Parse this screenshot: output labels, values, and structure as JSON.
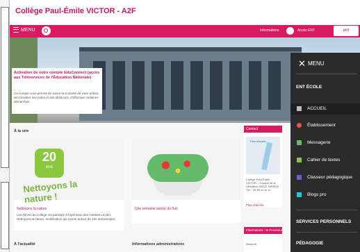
{
  "site": {
    "title": "Collège Paul-Émile VICTOR - A2F",
    "brand": "#d81b60"
  },
  "navbar": {
    "menu_label": "MENU",
    "right_a": "Informations",
    "right_b": "Accès ENT",
    "logo": "ent"
  },
  "hero": {
    "title": "Activation de votre compte EduConnect (accès aux Téléservices de l'Éducation Nationale)",
    "text": "Ce compte vous permet de suivre la scolarité de votre enfant, de consulter ses notes et ses absences, d'effectuer certaines démarches."
  },
  "sections": {
    "focus": "À la une",
    "news": "À l'actualité",
    "admin": "Informations administratives"
  },
  "cards": [
    {
      "badge_num": "20",
      "badge_sub": "ANS",
      "art": "Nettoyons la nature !",
      "caption": "Nettoyons la nature",
      "text": "Les élèves du collège ont participé à l'opération des Centres Leclerc Nettoyons la nature, mobilisation qui tourne autour du 20e anniversaire."
    },
    {
      "caption": "Une semaine autour du fruit",
      "text": ""
    }
  ],
  "map_card": {
    "head": "Contact",
    "map_label": "Plan d'accès",
    "address": "Collège Paul-Émile VICTOR – Groupe de la Libération 40220 TARNOS Tél. : 05 59 xx xx xx",
    "link": "Plan d'accès"
  },
  "info_card": {
    "head": "Informations : le Proviseur",
    "text": "Résumé"
  },
  "menu": {
    "close": "✕",
    "title": "MENU",
    "heading1": "ENT ÉCOLE",
    "items": [
      {
        "label": "ACCUEIL",
        "color": "#bdbdbd"
      },
      {
        "label": "Établissement",
        "color": "#ef5350"
      },
      {
        "label": "Messagerie",
        "color": "#66bb6a"
      },
      {
        "label": "Cahier de textes",
        "color": "#8bc34a"
      },
      {
        "label": "Classeur pédagogique",
        "color": "#7e57c2"
      },
      {
        "label": "Blogs pro",
        "color": "#26c6da"
      }
    ],
    "heading2": "SERVICES PERSONNELS",
    "heading3": "PÉDAGOGIE"
  }
}
